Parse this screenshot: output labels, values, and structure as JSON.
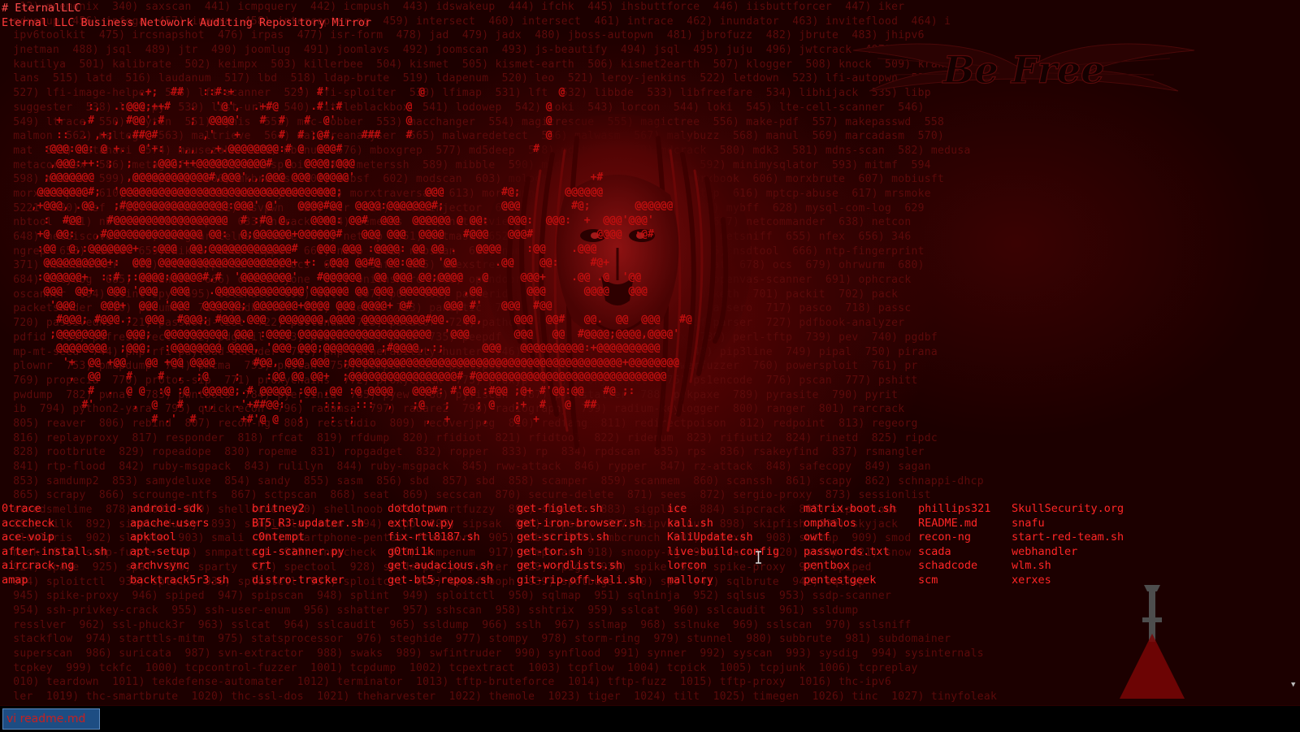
{
  "terminal": {
    "title": "EternalLLC",
    "header_line": "Eternal LLC Business Netowork Auditing Repository Mirror",
    "prompt_symbol": "#"
  },
  "wallpaper": {
    "banner_text": "Be Free",
    "noise_lines": [
      "   12) mnemonix  340) saxscan  441) icmpquery  442) icmpush  443) idswakeup  444) ifchk  445) ihsbuttforce  446) iisbuttforcer  447) iker",
      "  ndxemup  456) infoga  457) inguma  458) intercepter-ng  459) intersect  460) intersect  461) intrace  462) inundator  463) inviteflood  464) i",
      "  ipv6toolkit  475) ircsnapshot  476) irpas  477) isr-form  478) jad  479) jadx  480) jboss-autopwn  481) jbrofuzz  482) jbrute  483) jhipv6",
      "  jnetman  488) jsql  489) jtr  490) joomlug  491) joomlavs  492) joomscan  493) js-beautify  494) jsql  495) juju  496) jwtcrack  497) kacak",
      "  kautilya  501) kalibrate  502) keimpx  503) killerbee  504) kismet  505) kismet-earth  506) kismet2earth  507) klogger  508) knock  509) krake",
      "  lans  515) latd  516) laudanum  517) lbd  518) ldap-brute  519) ldapenum  520) leo  521) leroy-jenkins  522) letdown  523) lfi-autopwn  524",
      "  527) lfi-image-helper  528) lfi-scanner  529) lfi-sploiter  530) lfimap  531) lft  532) libbde  533) libfreefare  534) libhijack  535) libp",
      "  suggester  538) lisa.py  539) list-urls  540) littleblackbox  541) lodowep  542) loki  543) lorcon  544) loki  545) lte-cell-scanner  546)",
      "  549) ltrace  550) luyten  551) lynis  552) mac-robber  553) macchanger  554) magicrescue  555) magictree  556) make-pdf  557) makepasswd  558",
      "  malmon  562) maltego  563) maltrieve  564) malwareanalyser  565) malwaredetect  566) malwasm  567) malybuzz  568) manul  569) marcadasm  570)",
      "  mat  573) matahari  574) mausezahn  575) mbenum  576) mboxgrep  577) md5deep  578) mdbtools  579) mdcrack  580) mdk3  581) mdns-scan  582) medusa",
      "  metacoretex  586) metagoofil  587) metasploit  588) meterssh  589) mibble  590) middler  591) mimikatz  592) minimysqlator  593) mitmf  594",
      "  598) mitmer  599) mitmproxy  600) mkbrutus  601) mobsf  602) modscan  603) moloch  604) monocle  605) morxbook  606) morxbrute  607) mobiusft",
      "  morxcoinpwn  610) morxcrack  611) morxkeyfmt  612) morxtraversal  613) morxtunnel  614) mp3nema  615) mptcp  616) mptcp-abuse  617) mrsmoke",
      "  5221  620) msf  621) msfenum  622) msvpwn  623) mtr  624) multiinjector  625) multimac  626) multitun  627) mybff  628) mysql-com-log  629",
      "  nbtool  631) nbtscan  632) ncpfs  633) ncrack  634) nemesis  635) netactview  636) netbios-share-scanner  637) netcommander  638) netcon",
      "  648) netdiscover  649) netgear-telnetenable  650) netmap  651) netmask  652) netreconn  653) netscan  654) netsniff  655) nfex  656) 346",
      "  ngrep  658) nield  659) nikto  660) nipper  661) nmap  662) nmbscan  663) nomorexor  664) notspikefile  665) nsdtool  666) ntp-fingerprint",
      "  371) nsec3walker  672) ntlmsspparse  673) ocs  674) o-saft  675) obexstress  676) obfsproxy  677) oclhashcat  678) ocs  679) ohrwurm  680)",
      "  684) ollydbg  685) omnihash  686) onesixtyone  687) onionshare  688) opendoor  689) openvas-manager  690) openvas-scanner  691) ophcrack",
      "  oscanner  694) osint-spy  695) ostinato  696) owtf  697) p0f  698) packerid  699) packet-o-matic  700) packeth  701) packit  702) pack",
      "  packetsender  710) pacumen  711) padbuster  712) paketto  713) panoptic  714) paranoic  715) paros  716) parsero  717) pasco  718) passc",
      "  720) passivedns  721) password-list  722) pastenum  723) patator  724) pathod  725) pblat-count  726) pdf-parser  727) pdfbook-analyzer",
      "  pdfid  731) pdfresurrect  732) pdgmail  733) peach  734) peda  735) peepdf  736) peframe  737) pentbox  738) perl-tftp  739) pev  740) pgdbf",
      "  mp-mt-seed  744) php-rfi-payload-decoder  745) php-vulnerability-hunter  746) phpggc  747) phpsploit  748) pip3line  749) pipal  750) pirana",
      "  plownr  753) pmapdump  754) pmcma  755) pnscan  756) pompem  757) portspoof  758) posttester  759) powerfuzzer  760) powersploit  761) pr",
      "  769) propecia  770) protos-sip  771) proxychains  772) proxycheck  773) proxyp  774) proxytunnel  775) ps1encode  776) pscan  777) pshitt",
      "  pwdump  782) pwnat  783) pwntools  784) pyersinia  785) pyew  786) pyfiscan  787) pyinstaller  788) pykpaxe  789) pyrasite  790) pyrit",
      "  ib  794) python2-yara  795) quickrecon  796) radamsa  797) radare2  798) radiography  799) radium-keylogger  800) ranger  801) rarcrack",
      "  805) reaver  806) rebind  807) recon-ng  808) recstudio  809) recoverjpeg  810) redfang  811) redirectpoison  812) redpoint  813) regeorg",
      "  816) replayproxy  817) responder  818) rfcat  819) rfdump  820) rfidiot  821) rfidtool  822) ridenum  823) rifiuti2  824) rinetd  825) ripdc",
      "  828) rootbrute  829) ropeadope  830) ropeme  831) ropgadget  832) ropper  833) rp  834) rpdscan  835) rps  836) rsakeyfind  837) rsmangler",
      "  841) rtp-flood  842) ruby-msgpack  843) rulilyn  844) ruby-msgpack  845) rww-attack  846) rypper  847) rz-attack  848) safecopy  849) sagan",
      "  853) samdump2  853) samydeluxe  854) sandy  855) sasm  856) sbd  857) sbd  858) scamper  859) scanmem  860) scanssh  861) scapy  862) schnappi-dhcp",
      "  865) scrapy  866) scrounge-ntfs  867) sctpscan  868) seat  869) secscan  870) secure-delete  871) sees  872) sergio-proxy  873) sessionlist",
      "  ecredsmelime  878) sh00t  879) shellcode  880) shellnoob  881) shortfuzzy  882) shocker  883) sigploit  884) sipcrack  885) sipvicious",
      "  891) silk  892) simple-ducky  893) simple-lan-scan  894) sipp  895) sipsak  896) sipscan  897) sipvicious  898) skipfish  899) skyjack",
      "  slowloris  902) slurpie  903) smali  904) smartphone-pentest-framework  905) smbbf  906) smbcrunch  907) smbexec  908) smbmap  909) smod",
      "  mack  913) snmp-fuzzer  914) snmpattack  915) snmpcheck  916) snmpenum  917) snmpscan  918) snoopy-ng  919) snort  920) sn00p  921) snow",
      "  924) spade  925) spaf  926) sparty  927) spectool  928) spiderpig-pdffuzzer  929) spiga  930) spike  931) spike-proxy  932) spiped",
      "  934) sploitctl  935) sploit  936) sploitctl  937) sploitctl  938) spooftooph  939) spotbugs  940) sps  941) sqlbrute  942) sqlmap",
      "  945) spike-proxy  946) spiped  947) spipscan  948) splint  949) sploitctl  950) sqlmap  951) sqlninja  952) sqlsus  953) ssdp-scanner",
      "  954) ssh-privkey-crack  955) ssh-user-enum  956) sshatter  957) sshscan  958) sshtrix  959) sslcat  960) sslcaudit  961) ssldump",
      "  resslver  962) ssl-phuck3r  963) sslcat  964) sslcaudit  965) ssldump  966) sslh  967) sslmap  968) sslnuke  969) sslscan  970) sslsniff",
      "  stackflow  974) starttls-mitm  975) statsprocessor  976) steghide  977) stompy  978) storm-ring  979) stunnel  980) subbrute  981) subdomainer",
      "  superscan  986) suricata  987) svn-extractor  988) swaks  989) swfintruder  990) synflood  991) synner  992) syscan  993) sysdig  994) sysinternals",
      "  tcpkey  999) tckfc  1000) tcpcontrol-fuzzer  1001) tcpdump  1002) tcpextract  1003) tcpflow  1004) tcpick  1005) tcpjunk  1006) tcpreplay",
      "  010) teardown  1011) tekdefense-automater  1012) terminator  1013) tftp-bruteforce  1014) tftp-fuzz  1015) tftp-proxy  1016) thc-ipv6",
      "  ler  1019) thc-smartbrute  1020) thc-ssl-dos  1021) theharvester  1022) themole  1023) tiger  1024) tilt  1025) timegen  1026) tinc  1027) tinyfoleak"
    ],
    "ascii_lines": [
      "                  .+;  ##   ::#:+          '  #'              @                     @",
      "          :,  .:@@@;++#   .   '@',  .+#@     .#'.#          @                     @",
      "     +   ,#   , #@@',#    ;  @@@@'   #  #   #  @'           @                     @",
      "     ::  . ,+;  .##@#       ,'   +      #  # ;@#,    ###    #                     @",
      "   :@@@:@@: @ +.  @'+:  :,,  ,+.@@@@@@@@:# @  @@@#                              #",
      "    ,@@@:++: ;  ;   ;@@@;++@@@@@@@@@@@#  @  @@@@;@@@",
      "   ;@@@@@@@     ,@@@@@@@@@@@@#,@@@',,;@@@ @@@ @@@@@'                                     +#",
      "  @@@@@@@@#;  '@@@@@@@@@@@@@@@@@@@@@@@@@@@@@@@@@@;             @@@         #@;       @@@@@@",
      " ,+@@@, .@@.  ;#@@@@@@@@@@@@@@@@:@@@' @'   @@@@#@@  @@@@:@@@@@@@#;         @@@        #@;       @@@@@@",
      "   :  #@@    #@@@@@@@@@@@@@@@@@@  # :#@ @,   @@@@: @@#  @@@  @@@@@@ @ @@:   @@@:  @@@:  +  @@@'@@@'",
      "  +@ @@:   ,#@@@@@@@@@@@@@@@ @@:  @;@@@@@@+@@@@@@#   @@@ @@@  @@@@   #@@@   @@@#          @@@@  :@#",
      "  :@@  @,:@@@@@@@+  :@@@  @@;@@@@@@@@@@@@@#   @@@ @@@ :@@@@: @@ @@ .   @@@@    :@@    .@@@",
      "   @@@@@@@@@@+:  @@@ @@@@@@@@@@@@@@@@@@@@@+ +: .@@@ @@#@ @@:@@@  '@@      .@@    @@:     #@+",
      "  :@@@@@@+  ::# ;:@@@@:@@@@@#,#  '@@@@@@@@'   #@@@@@@  @@ @@@ @@;@@@@  .@     @@@+    .@@ .@  '@@",
      "   @@@  @@+  @@@ '@@@  @@@   .@@@@@@@@@@@@@@'@@@@@@ @@ @@@ @@@@@@@@  ,@@       @@@      @@@@   @@@",
      "    '@@@    @@@+  @@@ '@@@  @@@@@@; @@@@@@@+@@@@ @@@ @@@@+ @#     @@@ #'   @@@  #@@",
      "     #@@@; #@@@.:  @@@  #@@@; #@@@.@@@  @@@@@@@.@@@@ @@@@@@@@@@#@@.  @@,     @@@  @@#   @@.  @@  @@@   #@",
      "    ;@@@@@@@@   @@@;  @@@@@@@@@@ @@@ :@@@@ @@@@@@@@@@@@@@@@@@@@@  '@@@       @@@   @@  #@@@@;@@@@,@@@@'",
      "     @@@@@@@@  ;@@@;  :@@@@@@@@ @@@@, '@@@ @@@;@@@@@@@@ ;#@@@@,.:;      @@@   @@@@@@@@@@:+@@@@@@@@@@",
      "      '+  @@ +@@   @@ +@@ @@@@      #@@, @@@ @@@  ;@@@@@@@@@@@@@@@@@@@@@@@@@@@@@@@@@@@@@@@@@@@+@@@@@@@@",
      "       ,  @@    #    #  ,  ;@    ;    :@@ @@ @@+  ;@@@@@@@@@@@@@@@@@# #@@@@@@@@@@@@@@@@@@@@@@@@@@@@@@",
      "          #  .  @ @  :@ :@ .@@@@@;.# @@@@@ :@@ ,@@ :@ @@@@   @@@#: #'@@ :#@@ ;@+ #'@@:@@   #@ ;:",
      "         #'      ,  @   #   .,   .'+##@@:  '   ::;  :::  ,   ;@   ;    ; @   ;+  #   @  ##",
      "                    # .'  #       +#'@ @   :    :  ;           ,  +     ,    @  +"
    ]
  },
  "file_listing": {
    "columns": [
      [
        "0trace",
        "acccheck",
        "ace-voip",
        "after-install.sh",
        "aircrack-ng",
        "amap"
      ],
      [
        "android-sdk",
        "apache-users",
        "apktool",
        "apt-setup",
        "archvsync",
        "backtrack5r3.sh"
      ],
      [
        "britney2",
        "BT5_R3-updater.sh",
        "c0ntempt",
        "cgi-scanner.py",
        "crt",
        "distro-tracker"
      ],
      [
        "dotdotpwn",
        "extflow.py",
        "fix-rtl8187.sh",
        "g0tmi1k",
        "get-audacious.sh",
        "get-bt5-repos.sh"
      ],
      [
        "get-figlet.sh",
        "get-iron-browser.sh",
        "get-scripts.sh",
        "get-tor.sh",
        "get-wordlists.sh",
        "git-rip-off-kali.sh"
      ],
      [
        "ice",
        "kali.sh",
        "KaliUpdate.sh",
        "live-build-config",
        "lorcon",
        "mallory"
      ],
      [
        "matrix-boot.sh",
        "omphalos",
        "owtf",
        "passwords.txt",
        "pentbox",
        "pentestgeek"
      ],
      [
        "phillips321",
        "README.md",
        "recon-ng",
        "scada",
        "schadcode",
        "scm"
      ],
      [
        "SkullSecurity.org",
        "snafu",
        "start-red-team.sh",
        "webhandler",
        "wlm.sh",
        "xerxes"
      ]
    ]
  },
  "taskbar": {
    "active_item_label": "vi readme.md"
  },
  "colors": {
    "terminal_text": "#ff2626",
    "background": "#1c0000",
    "taskbar_item_bg": "#1d4d83"
  }
}
